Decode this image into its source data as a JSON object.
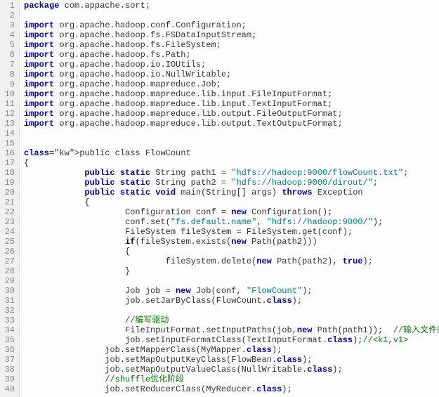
{
  "lines": [
    {
      "n": 1,
      "t": "package com.appache.sort;",
      "kw": [
        "package"
      ]
    },
    {
      "n": 2,
      "t": "",
      "kw": []
    },
    {
      "n": 3,
      "t": "import org.apache.hadoop.conf.Configuration;",
      "kw": [
        "import"
      ]
    },
    {
      "n": 4,
      "t": "import org.apache.hadoop.fs.FSDataInputStream;",
      "kw": [
        "import"
      ]
    },
    {
      "n": 5,
      "t": "import org.apache.hadoop.fs.FileSystem;",
      "kw": [
        "import"
      ]
    },
    {
      "n": 6,
      "t": "import org.apache.hadoop.fs.Path;",
      "kw": [
        "import"
      ]
    },
    {
      "n": 7,
      "t": "import org.apache.hadoop.io.IOUtils;",
      "kw": [
        "import"
      ]
    },
    {
      "n": 8,
      "t": "import org.apache.hadoop.io.NullWritable;",
      "kw": [
        "import"
      ]
    },
    {
      "n": 9,
      "t": "import org.apache.hadoop.mapreduce.Job;",
      "kw": [
        "import"
      ]
    },
    {
      "n": 10,
      "t": "import org.apache.hadoop.mapreduce.lib.input.FileInputFormat;",
      "kw": [
        "import"
      ]
    },
    {
      "n": 11,
      "t": "import org.apache.hadoop.mapreduce.lib.input.TextInputFormat;",
      "kw": [
        "import"
      ]
    },
    {
      "n": 12,
      "t": "import org.apache.hadoop.mapreduce.lib.output.FileOutputFormat;",
      "kw": [
        "import"
      ]
    },
    {
      "n": 13,
      "t": "import org.apache.hadoop.mapreduce.lib.output.TextOutputFormat;",
      "kw": [
        "import"
      ]
    },
    {
      "n": 14,
      "t": "",
      "kw": []
    },
    {
      "n": 15,
      "t": "",
      "kw": []
    },
    {
      "n": 16,
      "t": "public class FlowCount",
      "kw": [
        "public",
        "class"
      ]
    },
    {
      "n": 17,
      "t": "{",
      "kw": []
    },
    {
      "n": 18,
      "t": "            public static String path1 = \"hdfs://hadoop:9000/flowCount.txt\";",
      "kw": [
        "public",
        "static"
      ],
      "str": [
        "\"hdfs://hadoop:9000/flowCount.txt\""
      ]
    },
    {
      "n": 19,
      "t": "            public static String path2 = \"hdfs://hadoop:9000/dirout/\";",
      "kw": [
        "public",
        "static"
      ],
      "str": [
        "\"hdfs://hadoop:9000/dirout/\""
      ]
    },
    {
      "n": 20,
      "t": "            public static void main(String[] args) throws Exception",
      "kw": [
        "public",
        "static",
        "void",
        "throws"
      ]
    },
    {
      "n": 21,
      "t": "            {",
      "kw": []
    },
    {
      "n": 22,
      "t": "                    Configuration conf = new Configuration();",
      "kw": [
        "new"
      ]
    },
    {
      "n": 23,
      "t": "                    conf.set(\"fs.default.name\", \"hdfs://hadoop:9000/\");",
      "kw": [],
      "str": [
        "\"fs.default.name\"",
        "\"hdfs://hadoop:9000/\""
      ]
    },
    {
      "n": 24,
      "t": "                    FileSystem fileSystem = FileSystem.get(conf);",
      "kw": []
    },
    {
      "n": 25,
      "t": "                    if(fileSystem.exists(new Path(path2)))",
      "kw": [
        "if",
        "new"
      ]
    },
    {
      "n": 26,
      "t": "                    {",
      "kw": []
    },
    {
      "n": 27,
      "t": "                            fileSystem.delete(new Path(path2), true);",
      "kw": [
        "new",
        "true"
      ]
    },
    {
      "n": 28,
      "t": "                    }",
      "kw": []
    },
    {
      "n": 29,
      "t": "",
      "kw": []
    },
    {
      "n": 30,
      "t": "                    Job job = new Job(conf, \"FlowCount\");",
      "kw": [
        "new"
      ],
      "str": [
        "\"FlowCount\""
      ]
    },
    {
      "n": 31,
      "t": "                    job.setJarByClass(FlowCount.class);",
      "kw": [
        "class"
      ]
    },
    {
      "n": 32,
      "t": "",
      "kw": []
    },
    {
      "n": 33,
      "t": "                    //编写驱动",
      "kw": [],
      "cm": [
        "//编写驱动"
      ]
    },
    {
      "n": 34,
      "t": "                    FileInputFormat.setInputPaths(job,new Path(path1));  //输入文件的路",
      "kw": [
        "new"
      ],
      "cm": [
        "//输入文件的路"
      ]
    },
    {
      "n": 35,
      "t": "                    job.setInputFormatClass(TextInputFormat.class);//<k1,v1>",
      "kw": [
        "class"
      ],
      "cm": [
        "//<k1,v1>"
      ]
    },
    {
      "n": 36,
      "t": "                job.setMapperClass(MyMapper.class);",
      "kw": [
        "class"
      ]
    },
    {
      "n": 37,
      "t": "                job.setMapOutputKeyClass(FlowBean.class);",
      "kw": [
        "class"
      ]
    },
    {
      "n": 38,
      "t": "                job.setMapOutputValueClass(NullWritable.class);",
      "kw": [
        "class"
      ]
    },
    {
      "n": 39,
      "t": "                //shuffle优化阶段",
      "kw": [],
      "cm": [
        "//shuffle优化阶段"
      ]
    },
    {
      "n": 40,
      "t": "                job.setReducerClass(MyReducer.class);",
      "kw": [
        "class"
      ]
    }
  ]
}
